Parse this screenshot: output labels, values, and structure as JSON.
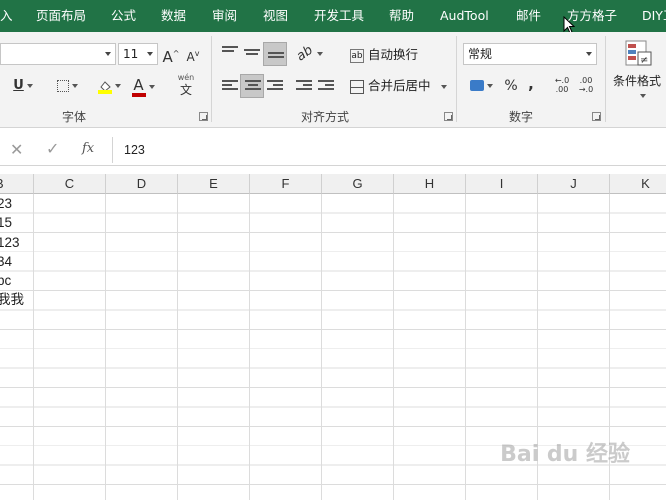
{
  "tabs": [
    "入",
    "页面布局",
    "公式",
    "数据",
    "审阅",
    "视图",
    "开发工具",
    "帮助",
    "AudTool",
    "邮件",
    "方方格子",
    "DIY工"
  ],
  "font": {
    "size": "11",
    "group_label": "字体",
    "increase_label": "A",
    "decrease_label": "A",
    "underline_label": "U",
    "font_color_label": "A",
    "phonetic_label": "wén",
    "phonetic_char": "文"
  },
  "alignment": {
    "wrap_text": "自动换行",
    "merge_center": "合并后居中",
    "group_label": "对齐方式"
  },
  "number": {
    "format": "常规",
    "percent": "%",
    "comma": ",",
    "group_label": "数字"
  },
  "styles": {
    "conditional_format": "条件格式"
  },
  "formula_bar": {
    "fx_label": "fx",
    "value": "123"
  },
  "columns": [
    "B",
    "C",
    "D",
    "E",
    "F",
    "G",
    "H",
    "I",
    "J",
    "K"
  ],
  "column_b_values": [
    "23",
    "15",
    "123",
    "34",
    "bc",
    "我我"
  ],
  "colors": {
    "ribbon_green": "#217346",
    "highlight_yellow": "#ffff00",
    "font_red": "#c00000"
  },
  "watermark": "Bai du 经验"
}
